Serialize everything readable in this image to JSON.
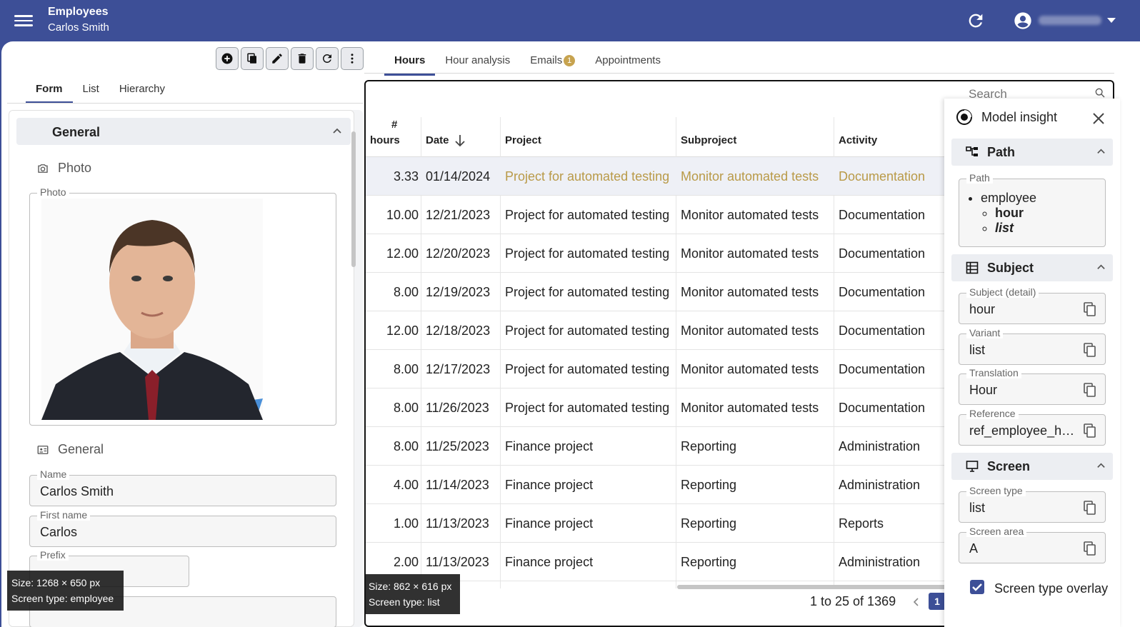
{
  "appbar": {
    "title": "Employees",
    "subtitle": "Carlos Smith"
  },
  "left_tabs": [
    "Form",
    "List",
    "Hierarchy"
  ],
  "form": {
    "section_title": "General",
    "photo_heading": "Photo",
    "photo_legend": "Photo",
    "general_heading": "General",
    "name_label": "Name",
    "name_value": "Carlos Smith",
    "first_name_label": "First name",
    "first_name_value": "Carlos",
    "prefix_label": "Prefix",
    "prefix_value": ""
  },
  "left_badge": {
    "size": "Size: 1268 × 650 px",
    "screen_type": "Screen type: employee"
  },
  "right_tabs": {
    "hours": "Hours",
    "hour_analysis": "Hour analysis",
    "emails": "Emails",
    "emails_count": "1",
    "appointments": "Appointments"
  },
  "grid": {
    "search_placeholder": "Search",
    "headers": {
      "hours_1": "#",
      "hours_2": "hours",
      "date": "Date",
      "project": "Project",
      "subproject": "Subproject",
      "activity": "Activity"
    },
    "rows": [
      {
        "hours": "3.33",
        "date": "01/14/2024",
        "project": "Project for automated testing",
        "subproject": "Monitor automated tests",
        "activity": "Documentation"
      },
      {
        "hours": "10.00",
        "date": "12/21/2023",
        "project": "Project for automated testing",
        "subproject": "Monitor automated tests",
        "activity": "Documentation"
      },
      {
        "hours": "12.00",
        "date": "12/20/2023",
        "project": "Project for automated testing",
        "subproject": "Monitor automated tests",
        "activity": "Documentation"
      },
      {
        "hours": "8.00",
        "date": "12/19/2023",
        "project": "Project for automated testing",
        "subproject": "Monitor automated tests",
        "activity": "Documentation"
      },
      {
        "hours": "12.00",
        "date": "12/18/2023",
        "project": "Project for automated testing",
        "subproject": "Monitor automated tests",
        "activity": "Documentation"
      },
      {
        "hours": "8.00",
        "date": "12/17/2023",
        "project": "Project for automated testing",
        "subproject": "Monitor automated tests",
        "activity": "Documentation"
      },
      {
        "hours": "8.00",
        "date": "11/26/2023",
        "project": "Project for automated testing",
        "subproject": "Monitor automated tests",
        "activity": "Documentation"
      },
      {
        "hours": "8.00",
        "date": "11/25/2023",
        "project": "Finance project",
        "subproject": "Reporting",
        "activity": "Administration"
      },
      {
        "hours": "4.00",
        "date": "11/14/2023",
        "project": "Finance project",
        "subproject": "Reporting",
        "activity": "Administration"
      },
      {
        "hours": "1.00",
        "date": "11/13/2023",
        "project": "Finance project",
        "subproject": "Reporting",
        "activity": "Reports"
      },
      {
        "hours": "2.00",
        "date": "11/13/2023",
        "project": "Finance project",
        "subproject": "Reporting",
        "activity": "Administration"
      }
    ],
    "pager_text": "1 to 25 of 1369",
    "current_page": "1"
  },
  "right_badge": {
    "size": "Size: 862 × 616 px",
    "screen_type": "Screen type: list"
  },
  "insight": {
    "title": "Model insight",
    "path_section": "Path",
    "path_legend": "Path",
    "path_items": {
      "l1": "employee",
      "l2": "hour",
      "l3": "list"
    },
    "subject_section": "Subject",
    "subject_detail_label": "Subject (detail)",
    "subject_detail_value": "hour",
    "variant_label": "Variant",
    "variant_value": "list",
    "translation_label": "Translation",
    "translation_value": "Hour",
    "reference_label": "Reference",
    "reference_value": "ref_employee_hour",
    "screen_section": "Screen",
    "screen_type_label": "Screen type",
    "screen_type_value": "list",
    "screen_area_label": "Screen area",
    "screen_area_value": "A",
    "overlay_label": "Screen type overlay"
  },
  "colors": {
    "primary": "#3d4f97",
    "highlight_text": "#b99a48",
    "selected_row": "#eef0f6"
  }
}
